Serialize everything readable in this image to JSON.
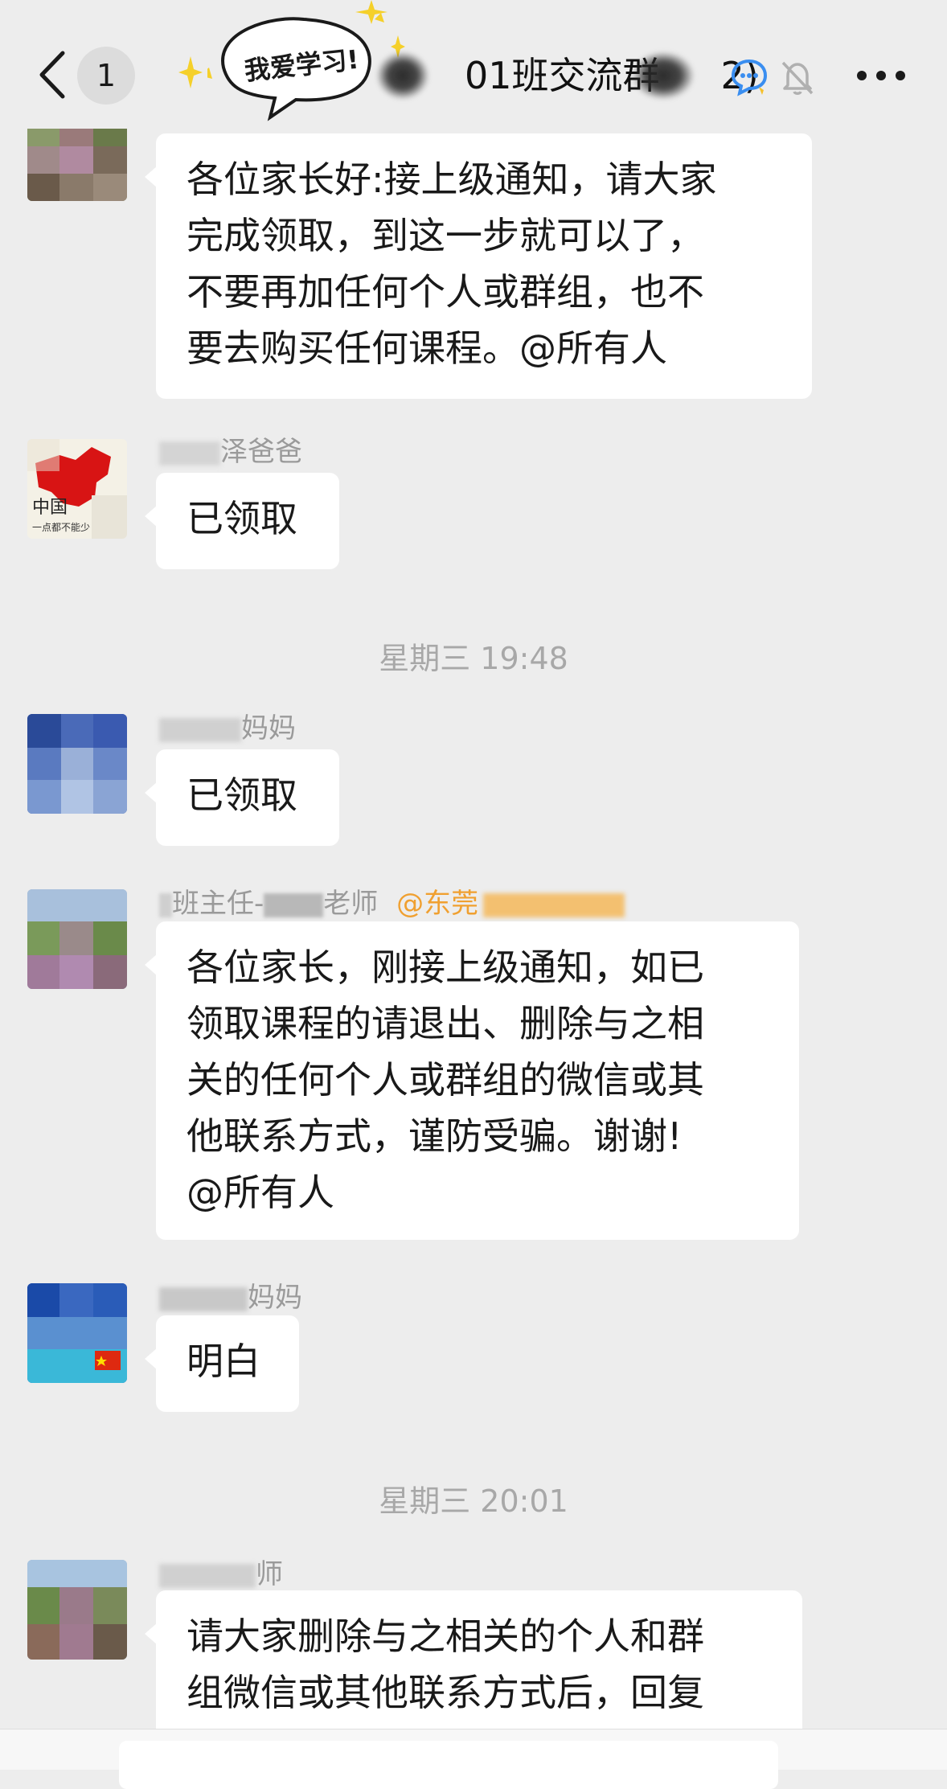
{
  "header": {
    "unread_count": "1",
    "sticker_text": "我爱学习!",
    "title_parts": [
      "",
      "01班交流群",
      "2)"
    ],
    "icons": [
      "back-chevron-icon",
      "chat-assistant-icon",
      "mute-bell-icon",
      "more-dots-icon"
    ]
  },
  "messages": [
    {
      "sender": "",
      "lines": [
        "各位家长好:接上级通知，请大家",
        "完成领取，到这一步就可以了，",
        "不要再加任何个人或群组，也不",
        "要去购买任何课程。@所有人"
      ]
    },
    {
      "sender": "泽爸爸",
      "lines": [
        "已领取"
      ]
    },
    {
      "sender": "妈妈",
      "lines": [
        "已领取"
      ]
    },
    {
      "sender_prefix": "班主任-",
      "sender": "老师",
      "sender_tag": "@东莞",
      "lines": [
        "各位家长，刚接上级通知，如已",
        "领取课程的请退出、删除与之相",
        "关的任何个人或群组的微信或其",
        "他联系方式，谨防受骗。谢谢!",
        "@所有人"
      ]
    },
    {
      "sender": "妈妈",
      "lines": [
        "明白"
      ]
    },
    {
      "sender": "师",
      "lines": [
        "请大家删除与之相关的个人和群",
        "组微信或其他联系方式后，回复"
      ]
    }
  ],
  "timestamps": [
    "星期三 19:48",
    "星期三 20:01"
  ],
  "colors": {
    "background": "#ededed",
    "bubble": "#ffffff",
    "timestamp": "#a8a8a8",
    "sender": "#9a9a9a",
    "tag": "#f0a030"
  }
}
